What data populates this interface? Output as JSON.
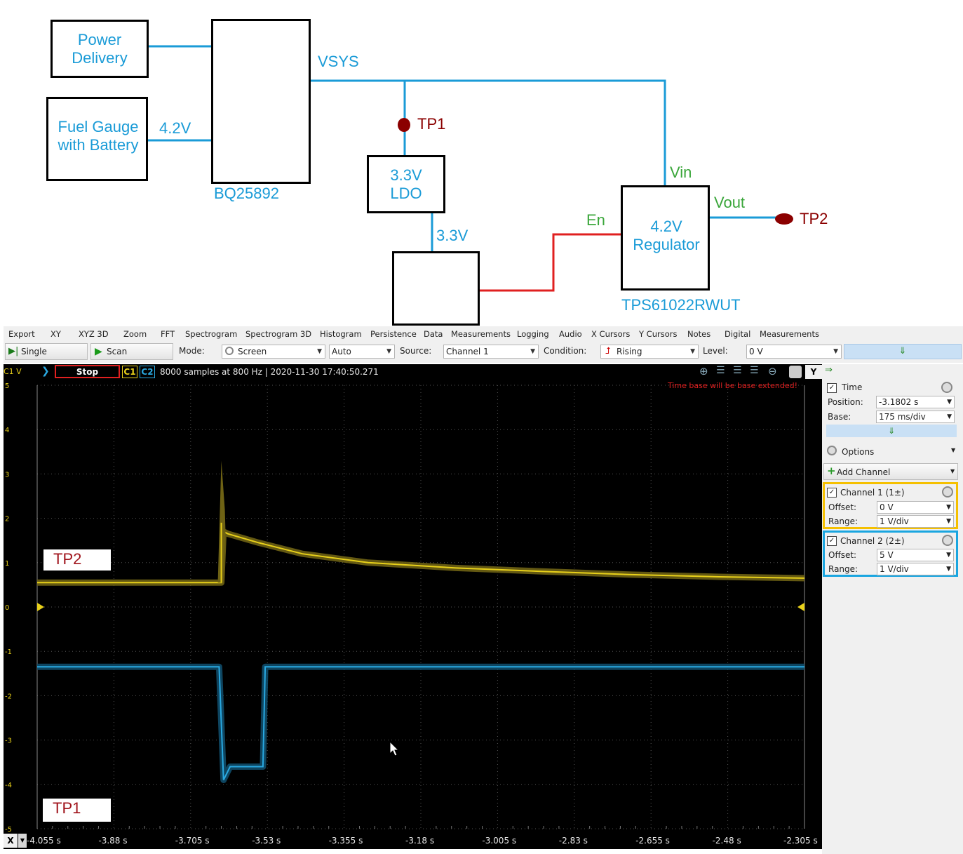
{
  "schematic": {
    "power_delivery": "Power\nDelivery",
    "fuel_gauge": "Fuel Gauge\nwith Battery",
    "v42_label": "4.2V",
    "bq_label": "BQ25892",
    "vsys_label": "VSYS",
    "tp1_label": "TP1",
    "tp2_label": "TP2",
    "ldo_label": "3.3V\nLDO",
    "v33_label": "3.3V",
    "en_label": "En",
    "vin_label": "Vin",
    "vout_label": "Vout",
    "regulator_label": "4.2V\nRegulator",
    "tps_label": "TPS61022RWUT",
    "colors": {
      "wire_blue": "#1a9bd7",
      "wire_red": "#e02020",
      "testpoint": "#8b0000",
      "label_green": "#3aa63a"
    }
  },
  "menu": [
    "Export",
    "XY",
    "XYZ 3D",
    "Zoom",
    "FFT",
    "Spectrogram",
    "Spectrogram 3D",
    "Histogram",
    "Persistence",
    "Data",
    "Measurements",
    "Logging",
    "Audio",
    "X Cursors",
    "Y Cursors",
    "Notes",
    "Digital",
    "Measurements"
  ],
  "toolbar": {
    "single": "Single",
    "scan": "Scan",
    "mode_label": "Mode:",
    "mode_value": "Screen",
    "auto_value": "Auto",
    "source_label": "Source:",
    "source_value": "Channel 1",
    "condition_label": "Condition:",
    "condition_value": "Rising",
    "level_label": "Level:",
    "level_value": "0 V",
    "down_arrow": "⇓"
  },
  "status": {
    "c1v": "C1 V",
    "state": "Stop",
    "c1": "C1",
    "c2": "C2",
    "info": "8000 samples at 800 Hz | 2020-11-30 17:40:50.271",
    "warning": "Time base will be base extended!",
    "y_btn": "Y"
  },
  "plot_labels": {
    "tp2": "TP2",
    "tp1": "TP1"
  },
  "chart_data": {
    "type": "line",
    "xlabel": "",
    "ylabel": "",
    "x_ticks": [
      "-4.055 s",
      "-3.88 s",
      "-3.705 s",
      "-3.53 s",
      "-3.355 s",
      "-3.18 s",
      "-3.005 s",
      "-2.83 s",
      "-2.655 s",
      "-2.48 s",
      "-2.305 s"
    ],
    "y_ticks": [
      "5",
      "4",
      "3",
      "2",
      "1",
      "0",
      "-1",
      "-2",
      "-3",
      "-4",
      "-5"
    ],
    "xlim": [
      -4.055,
      -2.305
    ],
    "ylim": [
      -5,
      5
    ],
    "series": [
      {
        "color": "#e8d01a",
        "x": [
          -4.055,
          -3.64,
          -3.635,
          -3.63,
          -3.62,
          -3.55,
          -3.45,
          -3.3,
          -3.1,
          -2.9,
          -2.7,
          -2.5,
          -2.305
        ],
        "values": [
          0.55,
          0.55,
          0.55,
          1.7,
          1.65,
          1.45,
          1.2,
          1.0,
          0.88,
          0.8,
          0.73,
          0.68,
          0.65
        ]
      },
      {
        "color": "#29a8e0",
        "x": [
          -4.055,
          -3.64,
          -3.63,
          -3.615,
          -3.55,
          -3.54,
          -3.535,
          -3.53,
          -2.305
        ],
        "values": [
          -1.35,
          -1.35,
          -3.9,
          -3.6,
          -3.6,
          -3.6,
          -1.35,
          -1.35,
          -1.35
        ]
      }
    ]
  },
  "xaxis": {
    "x_btn": "X"
  },
  "right_panel": {
    "time_title": "Time",
    "position_label": "Position:",
    "position_value": "-3.1802 s",
    "base_label": "Base:",
    "base_value": "175 ms/div",
    "down_arrow": "⇓",
    "options": "Options",
    "add_channel": "Add Channel",
    "ch1_title": "Channel 1 (1±)",
    "ch1_offset_label": "Offset:",
    "ch1_offset_value": "0 V",
    "ch1_range_label": "Range:",
    "ch1_range_value": "1 V/div",
    "ch2_title": "Channel 2 (2±)",
    "ch2_offset_label": "Offset:",
    "ch2_offset_value": "5 V",
    "ch2_range_label": "Range:",
    "ch2_range_value": "1 V/div",
    "ch1_color": "#f5c000",
    "ch2_color": "#1aa6e0"
  }
}
